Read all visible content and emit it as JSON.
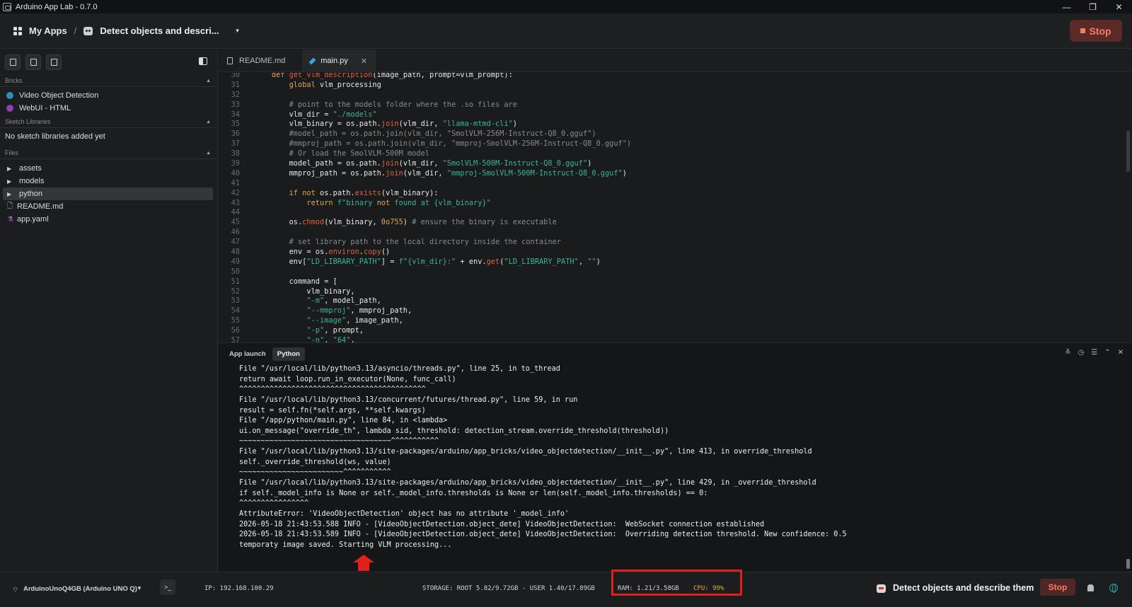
{
  "window": {
    "title": "Arduino App Lab - 0.7.0",
    "controls": [
      "—",
      "❐",
      "✕"
    ]
  },
  "header": {
    "my_apps_label": "My Apps",
    "separator": "/",
    "app_name": "Detect objects and descri...",
    "stop_label": "Stop"
  },
  "sidebar": {
    "bricks_header": "Bricks",
    "bricks": [
      {
        "label": "Video Object Detection",
        "color": "#2f8fb8"
      },
      {
        "label": "WebUI - HTML",
        "color": "#8b3fb5"
      }
    ],
    "sketch_header": "Sketch Libraries",
    "sketch_empty": "No sketch libraries added yet",
    "files_header": "Files",
    "files": [
      {
        "label": "assets",
        "type": "folder"
      },
      {
        "label": "models",
        "type": "folder"
      },
      {
        "label": "python",
        "type": "folder",
        "selected": true
      },
      {
        "label": "README.md",
        "type": "file"
      },
      {
        "label": "app.yaml",
        "type": "yaml"
      }
    ]
  },
  "tabs": [
    {
      "label": "README.md",
      "active": false
    },
    {
      "label": "main.py",
      "active": true
    }
  ],
  "editor": {
    "lines": [
      {
        "n": "30",
        "code": "    def get_vlm_description(image_path, prompt=vlm_prompt):"
      },
      {
        "n": "31",
        "code": "        global vlm_processing"
      },
      {
        "n": "32",
        "code": ""
      },
      {
        "n": "33",
        "code": "        # point to the models folder where the .so files are"
      },
      {
        "n": "34",
        "code": "        vlm_dir = \"./models\""
      },
      {
        "n": "35",
        "code": "        vlm_binary = os.path.join(vlm_dir, \"llama-mtmd-cli\")"
      },
      {
        "n": "36",
        "code": "        #model_path = os.path.join(vlm_dir, \"SmolVLM-256M-Instruct-Q8_0.gguf\")"
      },
      {
        "n": "37",
        "code": "        #mmproj_path = os.path.join(vlm_dir, \"mmproj-SmolVLM-256M-Instruct-Q8_0.gguf\")"
      },
      {
        "n": "38",
        "code": "        # Or load the SmolVLM-500M model"
      },
      {
        "n": "39",
        "code": "        model_path = os.path.join(vlm_dir, \"SmolVLM-500M-Instruct-Q8_0.gguf\")"
      },
      {
        "n": "40",
        "code": "        mmproj_path = os.path.join(vlm_dir, \"mmproj-SmolVLM-500M-Instruct-Q8_0.gguf\")"
      },
      {
        "n": "41",
        "code": ""
      },
      {
        "n": "42",
        "code": "        if not os.path.exists(vlm_binary):"
      },
      {
        "n": "43",
        "code": "            return f\"binary not found at {vlm_binary}\""
      },
      {
        "n": "44",
        "code": ""
      },
      {
        "n": "45",
        "code": "        os.chmod(vlm_binary, 0o755) # ensure the binary is executable"
      },
      {
        "n": "46",
        "code": ""
      },
      {
        "n": "47",
        "code": "        # set library path to the local directory inside the container"
      },
      {
        "n": "48",
        "code": "        env = os.environ.copy()"
      },
      {
        "n": "49",
        "code": "        env[\"LD_LIBRARY_PATH\"] = f\"{vlm_dir}:\" + env.get(\"LD_LIBRARY_PATH\", \"\")"
      },
      {
        "n": "50",
        "code": ""
      },
      {
        "n": "51",
        "code": "        command = ["
      },
      {
        "n": "52",
        "code": "            vlm_binary,"
      },
      {
        "n": "53",
        "code": "            \"-m\", model_path,"
      },
      {
        "n": "54",
        "code": "            \"--mmproj\", mmproj_path,"
      },
      {
        "n": "55",
        "code": "            \"--image\", image_path,"
      },
      {
        "n": "56",
        "code": "            \"-p\", prompt,"
      },
      {
        "n": "57",
        "code": "            \"-n\", \"64\","
      }
    ]
  },
  "console": {
    "tabs": [
      "App launch",
      "Python"
    ],
    "active_tab": "Python",
    "controls": [
      "≚",
      "◷",
      "☰",
      "⌃",
      "✕"
    ],
    "lines": [
      "File \"/usr/local/lib/python3.13/asyncio/threads.py\", line 25, in to_thread",
      "return await loop.run_in_executor(None, func_call)",
      "^^^^^^^^^^^^^^^^^^^^^^^^^^^^^^^^^^^^^^^^^^^",
      "File \"/usr/local/lib/python3.13/concurrent/futures/thread.py\", line 59, in run",
      "result = self.fn(*self.args, **self.kwargs)",
      "File \"/app/python/main.py\", line 84, in <lambda>",
      "ui.on_message(\"override_th\", lambda sid, threshold: detection_stream.override_threshold(threshold))",
      "~~~~~~~~~~~~~~~~~~~~~~~~~~~~~~~~~~~^^^^^^^^^^^",
      "File \"/usr/local/lib/python3.13/site-packages/arduino/app_bricks/video_objectdetection/__init__.py\", line 413, in override_threshold",
      "self._override_threshold(ws, value)",
      "~~~~~~~~~~~~~~~~~~~~~~~~^^^^^^^^^^^",
      "File \"/usr/local/lib/python3.13/site-packages/arduino/app_bricks/video_objectdetection/__init__.py\", line 429, in _override_threshold",
      "if self._model_info is None or self._model_info.thresholds is None or len(self._model_info.thresholds) == 0:",
      "^^^^^^^^^^^^^^^^",
      "AttributeError: 'VideoObjectDetection' object has no attribute '_model_info'",
      "2026-05-18 21:43:53.588 INFO - [VideoObjectDetection.object_dete] VideoObjectDetection:  WebSocket connection established",
      "2026-05-18 21:43:53.589 INFO - [VideoObjectDetection.object_dete] VideoObjectDetection:  Overriding detection threshold. New confidence: 0.5",
      "temporaty image saved. Starting VLM processing..."
    ]
  },
  "statusbar": {
    "board": "ArduinoUnoQ4GB (Arduino UNO Q)",
    "terminal": ">_",
    "ip": "IP: 192.168.100.29",
    "storage": "STORAGE: ROOT 5.82/9.72GB - USER 1.40/17.89GB",
    "ram": "RAM: 1.21/3.58GB",
    "cpu": "CPU: 99%",
    "app_name": "Detect objects and describe them",
    "stop_label": "Stop"
  }
}
